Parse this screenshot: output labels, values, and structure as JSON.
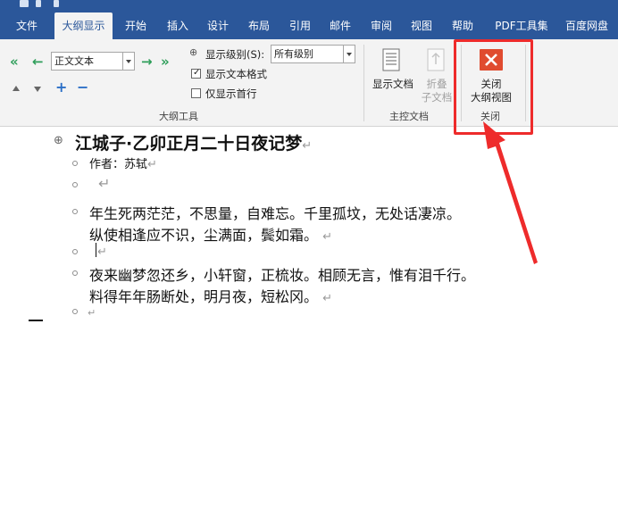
{
  "tabs": [
    {
      "label": "文件"
    },
    {
      "label": "大纲显示"
    },
    {
      "label": "开始"
    },
    {
      "label": "插入"
    },
    {
      "label": "设计"
    },
    {
      "label": "布局"
    },
    {
      "label": "引用"
    },
    {
      "label": "邮件"
    },
    {
      "label": "审阅"
    },
    {
      "label": "视图"
    },
    {
      "label": "帮助"
    },
    {
      "label": "PDF工具集"
    },
    {
      "label": "百度网盘"
    }
  ],
  "outline_tools": {
    "level_combo_value": "正文文本",
    "show_level_label": "显示级别(S):",
    "show_level_value": "所有级别",
    "show_text_format_label": "显示文本格式",
    "show_text_format_checked": true,
    "show_first_line_label": "仅显示首行",
    "show_first_line_checked": false,
    "group_label": "大纲工具"
  },
  "master_document": {
    "show_document_label": "显示文档",
    "collapse_line1": "折叠",
    "collapse_line2": "子文档",
    "group_label": "主控文档"
  },
  "close_group": {
    "close_line1": "关闭",
    "close_line2": "大纲视图",
    "group_label": "关闭"
  },
  "document": {
    "title": "江城子·乙卯正月二十日夜记梦",
    "author": "作者：苏轼",
    "para1_line1": "年生死两茫茫，不思量，自难忘。千里孤坟，无处话凄凉。",
    "para1_line2": "纵使相逢应不识，尘满面，鬓如霜。",
    "para2_line1": "夜来幽梦忽还乡，小轩窗，正梳妆。相顾无言，惟有泪千行。",
    "para2_line2": "料得年年肠断处，明月夜，短松冈。",
    "pilcrow": "↵"
  },
  "colors": {
    "ribbon_blue": "#2b579a",
    "highlight_red": "#ee2b2b",
    "close_icon_red": "#e04b2f",
    "arrow_green": "#2e9e5a",
    "plus_blue": "#2b6fc7"
  }
}
